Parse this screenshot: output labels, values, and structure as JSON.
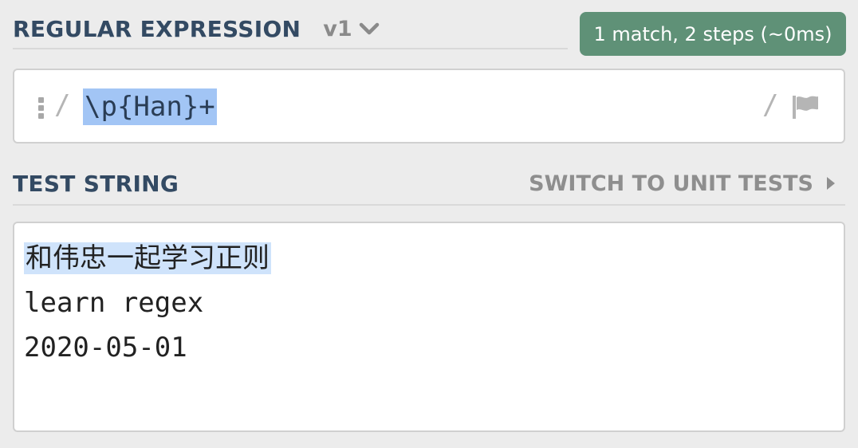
{
  "regex_section": {
    "title": "REGULAR EXPRESSION",
    "version": "v1",
    "match_info": "1 match, 2 steps (~0ms)",
    "delimiter_open": "/",
    "delimiter_close": "/",
    "pattern": "\\p{Han}+"
  },
  "test_section": {
    "title": "TEST STRING",
    "switch_label": "SWITCH TO UNIT TESTS",
    "lines": [
      "和伟忠一起学习正则",
      "learn regex",
      "2020-05-01"
    ]
  },
  "colors": {
    "header_text": "#334a63",
    "match_badge": "#5f9177",
    "regex_highlight": "#a2c5f5",
    "match_highlight": "#cfe3fb",
    "muted_text": "#8e8e8e"
  },
  "icons": {
    "version_toggle": "chevron-down-icon",
    "drag": "drag-handle-icon",
    "flags": "flag-icon",
    "switch": "caret-right-icon"
  }
}
